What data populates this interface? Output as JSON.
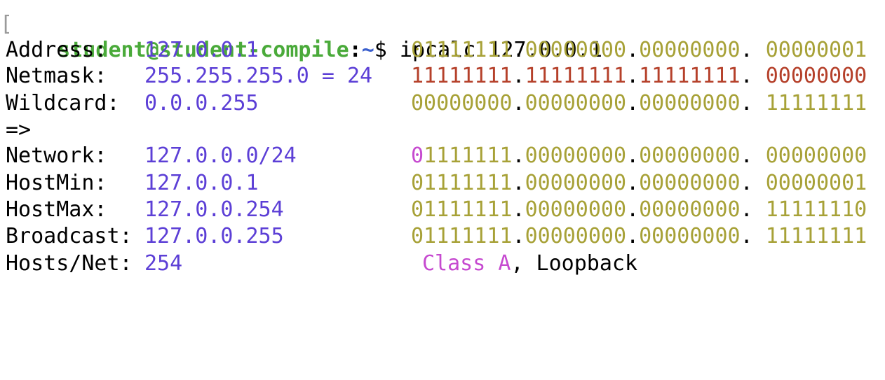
{
  "prompt": {
    "bracket": "[",
    "user_host": "student@student-compile",
    "separator": ":",
    "path": "~",
    "symbol": "$",
    "command": " ipcalc 127.0.0.1"
  },
  "rows": {
    "address": {
      "label": "Address:",
      "value": "127.0.0.1",
      "b1": "01111111",
      "b2": "00000000",
      "b3": "00000000",
      "b4": "00000001"
    },
    "netmask": {
      "label": "Netmask:",
      "value": "255.255.255.0 = 24",
      "b1": "11111111",
      "b2": "11111111",
      "b3": "11111111",
      "b4": "00000000"
    },
    "wildcard": {
      "label": "Wildcard:",
      "value": "0.0.0.255",
      "b1": "00000000",
      "b2": "00000000",
      "b3": "00000000",
      "b4": "11111111"
    },
    "arrow": "=>",
    "network": {
      "label": "Network:",
      "value": "127.0.0.0/24",
      "b1_first": "0",
      "b1_rest": "1111111",
      "b2": "00000000",
      "b3": "00000000",
      "b4": "00000000"
    },
    "hostmin": {
      "label": "HostMin:",
      "value": "127.0.0.1",
      "b1": "01111111",
      "b2": "00000000",
      "b3": "00000000",
      "b4": "00000001"
    },
    "hostmax": {
      "label": "HostMax:",
      "value": "127.0.0.254",
      "b1": "01111111",
      "b2": "00000000",
      "b3": "00000000",
      "b4": "11111110"
    },
    "broadcast": {
      "label": "Broadcast:",
      "value": "127.0.0.255",
      "b1": "01111111",
      "b2": "00000000",
      "b3": "00000000",
      "b4": "11111111"
    },
    "hosts": {
      "label": "Hosts/Net:",
      "value": "254",
      "class": "Class A",
      "class_suffix": ", Loopback"
    }
  },
  "colors": {
    "prompt_user": "#4aaa3a",
    "prompt_path": "#3a5fcd",
    "value": "#5c3fd6",
    "binary": "#a7a137",
    "netmask_binary": "#b5402a",
    "class_highlight": "#c64ad0"
  }
}
